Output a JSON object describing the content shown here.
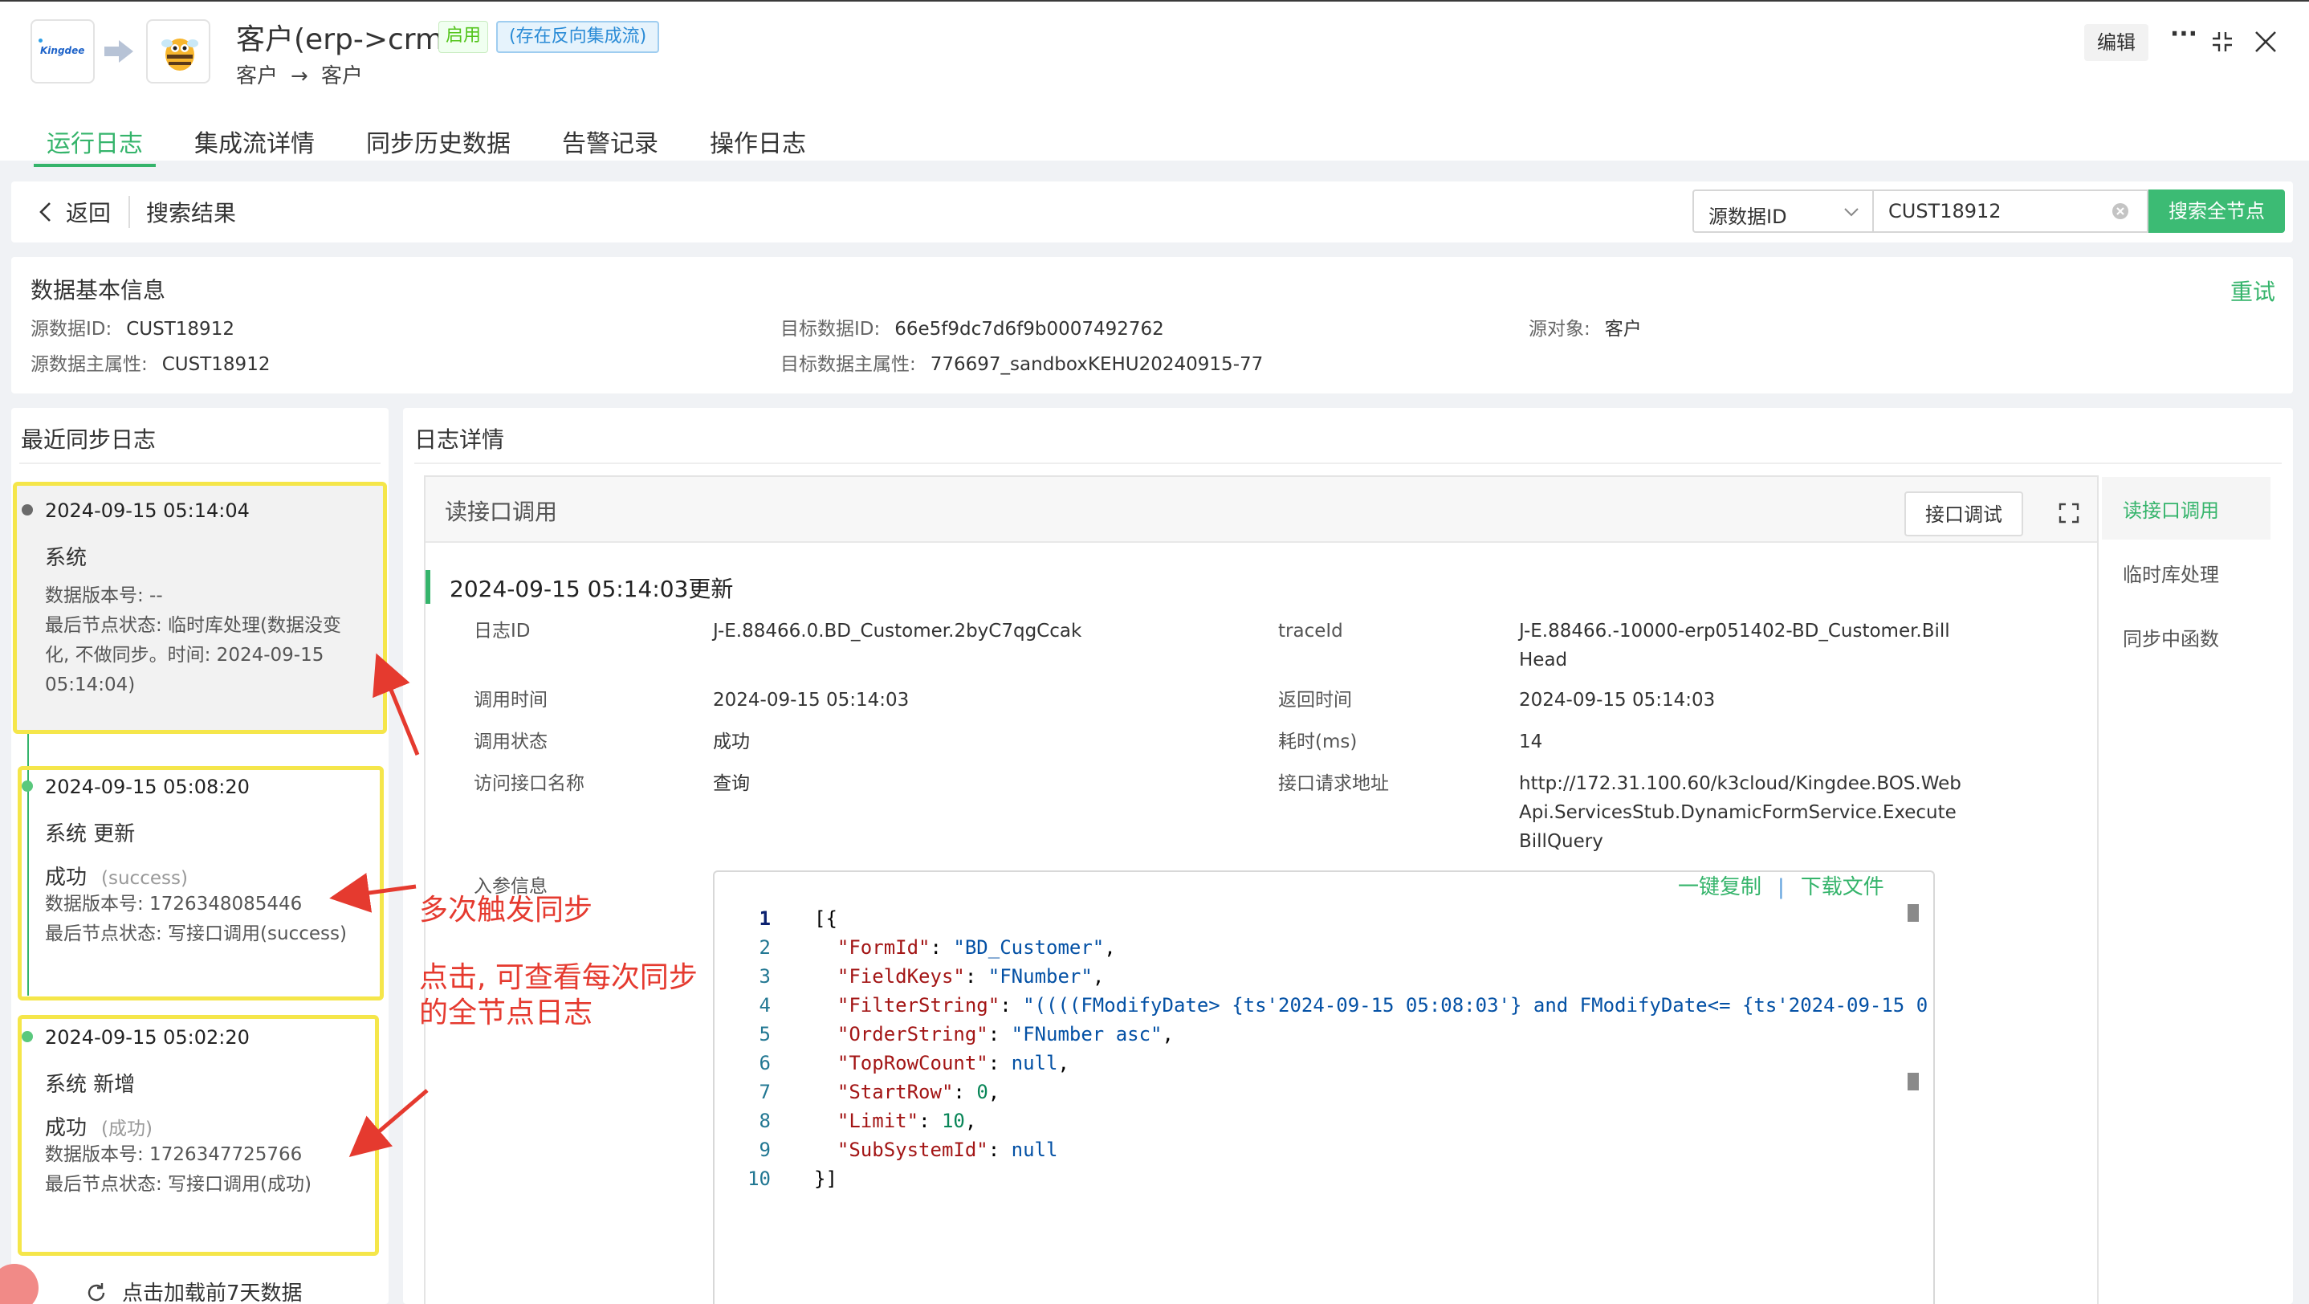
{
  "header": {
    "kingdee_logo_text": "Kingdee",
    "title": "客户(erp->crm)",
    "status_tag": "启用",
    "reverse_tag": "(存在反向集成流)",
    "sub_from": "客户",
    "sub_to": "客户",
    "edit_label": "编辑",
    "more_label": "···"
  },
  "tabs": [
    {
      "label": "运行日志",
      "active": true
    },
    {
      "label": "集成流详情",
      "active": false
    },
    {
      "label": "同步历史数据",
      "active": false
    },
    {
      "label": "告警记录",
      "active": false
    },
    {
      "label": "操作日志",
      "active": false
    }
  ],
  "search_bar": {
    "back_label": "返回",
    "result_label": "搜索结果",
    "select_value": "源数据ID",
    "input_value": "CUST18912",
    "search_button": "搜索全节点"
  },
  "basic_info": {
    "title": "数据基本信息",
    "retry_label": "重试",
    "fields": [
      {
        "label": "源数据ID:",
        "value": "CUST18912"
      },
      {
        "label": "源数据主属性:",
        "value": "CUST18912"
      },
      {
        "label": "目标数据ID:",
        "value": "66e5f9dc7d6f9b0007492762"
      },
      {
        "label": "目标数据主属性:",
        "value": "776697_sandboxKEHU20240915-77"
      },
      {
        "label": "源对象:",
        "value": "客户"
      }
    ]
  },
  "recent_logs": {
    "title": "最近同步日志",
    "load_more": "点击加载前7天数据",
    "items": [
      {
        "time": "2024-09-15 05:14:04",
        "system": "系统",
        "line1": "数据版本号: --",
        "line2": "最后节点状态: 临时库处理(数据没变",
        "line3": "化, 不做同步。时间: 2024-09-15",
        "line4": "05:14:04)"
      },
      {
        "time": "2024-09-15 05:08:20",
        "system": "系统   更新",
        "status": "成功",
        "status_note": "(success)",
        "version": "数据版本号: 1726348085446",
        "last_node": "最后节点状态: 写接口调用(success)"
      },
      {
        "time": "2024-09-15 05:02:20",
        "system": "系统   新增",
        "status": "成功",
        "status_note": "(成功)",
        "version": "数据版本号: 1726347725766",
        "last_node": "最后节点状态: 写接口调用(成功)"
      }
    ]
  },
  "log_detail": {
    "title": "日志详情",
    "section_title": "读接口调用",
    "debug_button": "接口调试",
    "update_time": "2024-09-15 05:14:03更新",
    "fields_left": [
      {
        "label": "日志ID",
        "value": "J-E.88466.0.BD_Customer.2byC7qgCcak"
      },
      {
        "label": "调用时间",
        "value": "2024-09-15 05:14:03"
      },
      {
        "label": "调用状态",
        "value": "成功"
      },
      {
        "label": "访问接口名称",
        "value": "查询"
      }
    ],
    "fields_right": [
      {
        "label": "traceId",
        "value_lines": [
          "J-E.88466.-10000-erp051402-BD_Customer.Bill",
          "Head"
        ]
      },
      {
        "label": "返回时间",
        "value_lines": [
          "2024-09-15 05:14:03"
        ]
      },
      {
        "label": "耗时(ms)",
        "value_lines": [
          "14"
        ]
      },
      {
        "label": "接口请求地址",
        "value_lines": [
          "http://172.31.100.60/k3cloud/Kingdee.BOS.Web",
          "Api.ServicesStub.DynamicFormService.Execute",
          "BillQuery"
        ]
      }
    ],
    "param_label": "入参信息",
    "copy_label": "一键复制",
    "separator": "|",
    "download_label": "下载文件",
    "line_numbers": [
      "1",
      "2",
      "3",
      "4",
      "5",
      "6",
      "7",
      "8",
      "9",
      "10"
    ],
    "code": {
      "l1": "[{",
      "formid_key": "\"FormId\"",
      "formid_val": "\"BD_Customer\"",
      "fieldkeys_key": "\"FieldKeys\"",
      "fieldkeys_val": "\"FNumber\"",
      "filter_key": "\"FilterString\"",
      "filter_val": "\"((((FModifyDate> {ts'2024-09-15 05:08:03'} and FModifyDate<= {ts'2024-09-15 0",
      "order_key": "\"OrderString\"",
      "order_val": "\"FNumber asc\"",
      "toprow_key": "\"TopRowCount\"",
      "toprow_val": "null",
      "startrow_key": "\"StartRow\"",
      "startrow_val": "0",
      "limit_key": "\"Limit\"",
      "limit_val": "10",
      "subsys_key": "\"SubSystemId\"",
      "subsys_val": "null",
      "l10": "}]"
    }
  },
  "side_nav": [
    {
      "label": "读接口调用",
      "active": true
    },
    {
      "label": "临时库处理",
      "active": false
    },
    {
      "label": "同步中函数",
      "active": false
    }
  ],
  "annotations": {
    "multi_trigger": "多次触发同步",
    "click_hint_1": "点击, 可查看每次同步",
    "click_hint_2": "的全节点日志"
  },
  "colors": {
    "accent": "#35b46b",
    "highlight_border": "#f5e64a",
    "annotation": "#e53a2f"
  }
}
